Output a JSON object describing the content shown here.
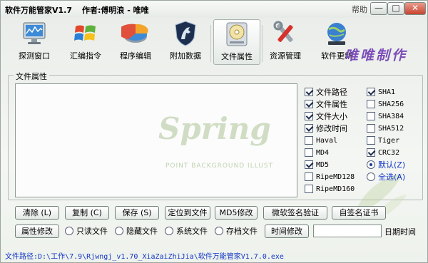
{
  "window": {
    "title": "软件万能管家V1.7",
    "author": "作者:傅明浪 - 唯唯",
    "help": "帮助",
    "min": "—",
    "max": "□",
    "close": "✕"
  },
  "toolbar": {
    "items": [
      {
        "label": "探测窗口",
        "icon": "monitor-icon"
      },
      {
        "label": "汇编指令",
        "icon": "windows-logo-icon"
      },
      {
        "label": "程序编辑",
        "icon": "pie-chart-icon"
      },
      {
        "label": "附加数据",
        "icon": "horse-shield-icon"
      },
      {
        "label": "文件属性",
        "icon": "disc-drive-icon"
      },
      {
        "label": "资源管理",
        "icon": "tools-icon"
      },
      {
        "label": "软件更新",
        "icon": "globe-update-icon"
      }
    ],
    "active_index": 4,
    "brand": "唯唯制作"
  },
  "group": {
    "title": "文件属性",
    "watermark": "Spring",
    "watermark_sub": "POINT BACKGROUND ILLUST"
  },
  "checks_col1": [
    {
      "label": "文件路径",
      "checked": true
    },
    {
      "label": "文件属性",
      "checked": true
    },
    {
      "label": "文件大小",
      "checked": true
    },
    {
      "label": "修改时间",
      "checked": true
    },
    {
      "label": "Haval",
      "checked": false
    },
    {
      "label": "MD4",
      "checked": false
    },
    {
      "label": "MD5",
      "checked": true
    },
    {
      "label": "RipeMD128",
      "checked": false
    },
    {
      "label": "RipeMD160",
      "checked": false
    }
  ],
  "checks_col2": [
    {
      "label": "SHA1",
      "checked": true
    },
    {
      "label": "SHA256",
      "checked": false
    },
    {
      "label": "SHA384",
      "checked": false
    },
    {
      "label": "SHA512",
      "checked": false
    },
    {
      "label": "Tiger",
      "checked": false
    },
    {
      "label": "CRC32",
      "checked": true
    }
  ],
  "radios": [
    {
      "label": "默认(Z)",
      "selected": true
    },
    {
      "label": "全选(A)",
      "selected": false
    }
  ],
  "buttons_row1": [
    "清除 (L)",
    "复制 (C)",
    "保存 (S)",
    "定位到文件",
    "MD5修改",
    "微软签名验证",
    "自签名证书"
  ],
  "row2": {
    "attr_button": "属性修改",
    "radios": [
      "只读文件",
      "隐藏文件",
      "系统文件",
      "存档文件"
    ],
    "time_button": "时间修改",
    "date_value": "",
    "date_label": "日期时间"
  },
  "status": {
    "path": "文件路径:D:\\工作\\7.9\\Rjwngj_v1.70_XiaZaiZhiJia\\软件万能管家V1.7.0.exe"
  }
}
